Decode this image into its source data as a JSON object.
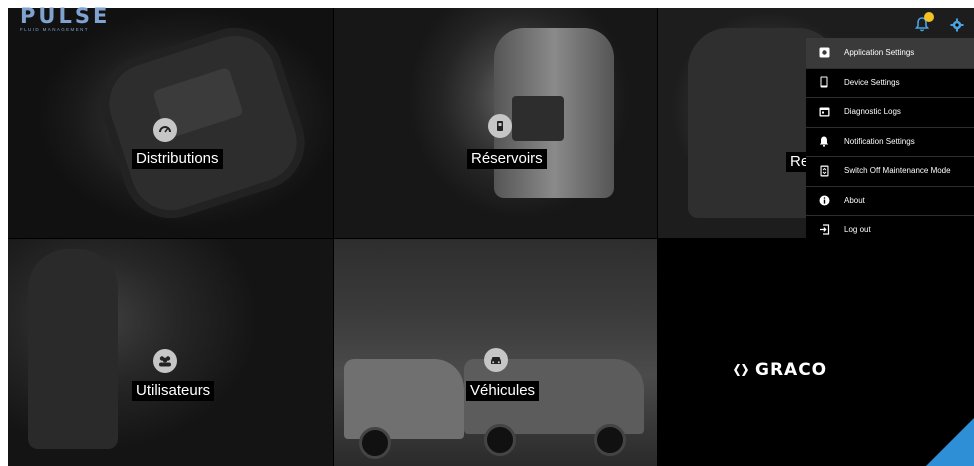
{
  "app": {
    "logo_main": "PULSE",
    "logo_sub": "FLUID MANAGEMENT"
  },
  "header": {
    "notification_icon": "bell-icon",
    "settings_icon": "gear-icon",
    "notification_badge_color": "#f2c322",
    "icon_color": "#4aa3e0"
  },
  "tiles": [
    {
      "label": "Distributions",
      "icon": "dispense-meter-icon"
    },
    {
      "label": "Réservoirs",
      "icon": "tank-icon"
    },
    {
      "label": "Re",
      "icon": ""
    },
    {
      "label": "Utilisateurs",
      "icon": "users-icon"
    },
    {
      "label": "Véhicules",
      "icon": "car-icon"
    }
  ],
  "brand": {
    "name": "GRACO",
    "accent_color": "#2f8fd6"
  },
  "menu": {
    "items": [
      {
        "label": "Application Settings",
        "icon": "app-settings-icon",
        "active": true
      },
      {
        "label": "Device Settings",
        "icon": "phone-icon",
        "active": false
      },
      {
        "label": "Diagnostic Logs",
        "icon": "calendar-icon",
        "active": false
      },
      {
        "label": "Notification Settings",
        "icon": "bell-icon",
        "active": false
      },
      {
        "label": "Switch Off Maintenance Mode",
        "icon": "maintenance-icon",
        "active": false
      },
      {
        "label": "About",
        "icon": "info-icon",
        "active": false
      },
      {
        "label": "Log out",
        "icon": "logout-icon",
        "active": false
      }
    ]
  }
}
